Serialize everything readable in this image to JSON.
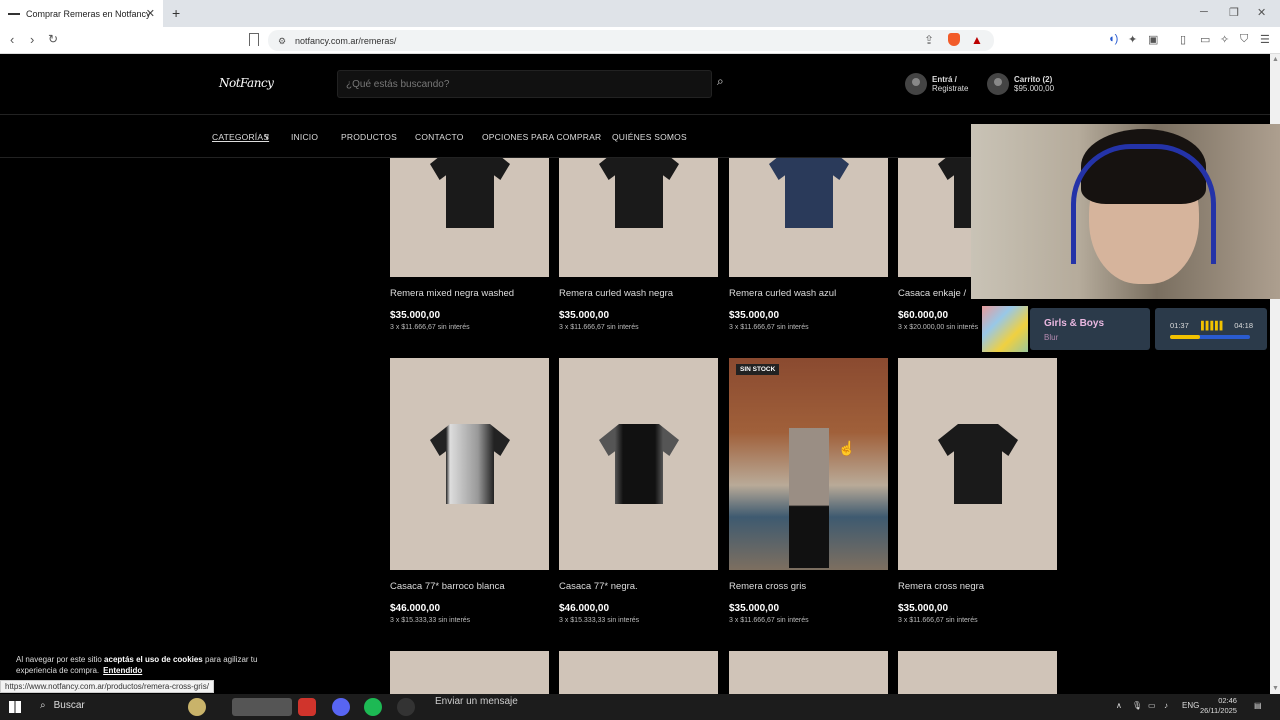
{
  "browser": {
    "tab_title": "Comprar Remeras en Notfancy",
    "url": "notfancy.com.ar/remeras/",
    "status_url": "https://www.notfancy.com.ar/productos/remera-cross-gris/"
  },
  "header": {
    "logo": "NotFancy",
    "search_placeholder": "¿Qué estás buscando?",
    "account_line1": "Entrá /",
    "account_line2": "Registrate",
    "cart_line1": "Carrito (2)",
    "cart_line2": "$95.000,00"
  },
  "nav": {
    "items": [
      "CATEGORÍAS",
      "INICIO",
      "PRODUCTOS",
      "CONTACTO",
      "OPCIONES PARA COMPRAR",
      "QUIÉNES SOMOS"
    ]
  },
  "products_row1": [
    {
      "name": "Remera mixed negra washed",
      "price": "$35.000,00",
      "installments": "3 x $11.666,67 sin interés"
    },
    {
      "name": "Remera curled wash negra",
      "price": "$35.000,00",
      "installments": "3 x $11.666,67 sin interés"
    },
    {
      "name": "Remera curled wash azul",
      "price": "$35.000,00",
      "installments": "3 x $11.666,67 sin interés"
    },
    {
      "name": "Casaca enkaje /",
      "price": "$60.000,00",
      "installments": "3 x $20.000,00 sin interés"
    }
  ],
  "products_row2": [
    {
      "name": "Casaca 77* barroco blanca",
      "price": "$46.000,00",
      "installments": "3 x $15.333,33 sin interés"
    },
    {
      "name": "Casaca 77* negra.",
      "price": "$46.000,00",
      "installments": "3 x $15.333,33 sin interés"
    },
    {
      "name": "Remera cross gris",
      "price": "$35.000,00",
      "installments": "3 x $11.666,67 sin interés",
      "badge": "SIN STOCK"
    },
    {
      "name": "Remera cross negra",
      "price": "$35.000,00",
      "installments": "3 x $11.666,67 sin interés"
    }
  ],
  "cookie": {
    "text1": "Al navegar por este sitio ",
    "bold": "aceptás el uso de cookies",
    "text2": " para agilizar tu experiencia de compra.",
    "button": "Entendido"
  },
  "music": {
    "title": "Girls & Boys",
    "artist": "Blur",
    "current": "01:37",
    "total": "04:18",
    "progress": 0.38
  },
  "taskbar": {
    "search": "Buscar",
    "message_placeholder": "Enviar un mensaje",
    "lang": "ENG",
    "time": "02:46",
    "date": "26/11/2025"
  }
}
